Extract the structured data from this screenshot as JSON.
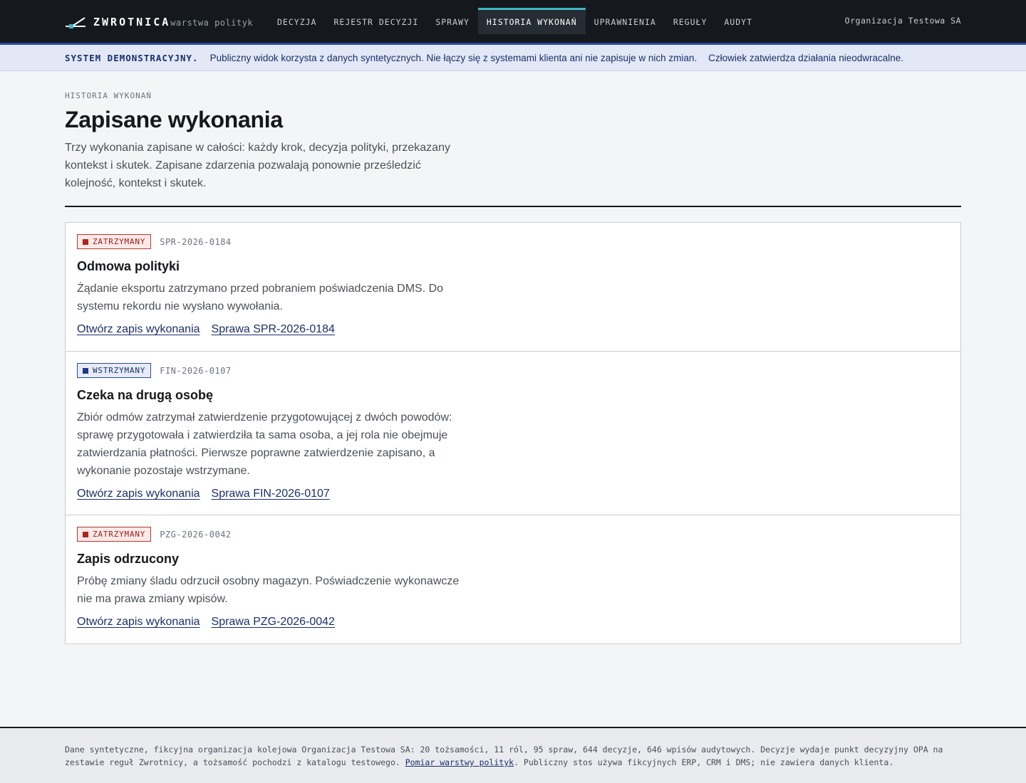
{
  "brand": {
    "name": "ZWROTNICA",
    "subtitle": "warstwa polityk",
    "logo_icon": "track-switch-icon"
  },
  "nav": {
    "items": [
      {
        "label": "DECYZJA",
        "active": false
      },
      {
        "label": "REJESTR DECYZJI",
        "active": false
      },
      {
        "label": "SPRAWY",
        "active": false
      },
      {
        "label": "HISTORIA WYKONAŃ",
        "active": true
      },
      {
        "label": "UPRAWNIENIA",
        "active": false
      },
      {
        "label": "REGUŁY",
        "active": false
      },
      {
        "label": "AUDYT",
        "active": false
      }
    ],
    "org": "Organizacja Testowa SA"
  },
  "banner": {
    "strong": "SYSTEM DEMONSTRACYJNY.",
    "text1": "Publiczny widok korzysta z danych syntetycznych. Nie łączy się z systemami klienta ani nie zapisuje w nich zmian.",
    "text2": "Człowiek zatwierdza działania nieodwracalne."
  },
  "header": {
    "eyebrow": "HISTORIA WYKONAŃ",
    "title": "Zapisane wykonania",
    "lead": "Trzy wykonania zapisane w całości: każdy krok, decyzja polityki, przekazany kontekst i skutek. Zapisane zdarzenia pozwalają ponownie prześledzić kolejność, kontekst i skutek."
  },
  "runs": [
    {
      "status": "ZATRZYMANY",
      "case_id": "SPR-2026-0184",
      "title": "Odmowa polityki",
      "description": "Żądanie eksportu zatrzymano przed pobraniem poświadczenia DMS. Do systemu rekordu nie wysłano wywołania.",
      "link_record": "Otwórz zapis wykonania",
      "link_case": "Sprawa SPR-2026-0184"
    },
    {
      "status": "WSTRZYMANY",
      "case_id": "FIN-2026-0107",
      "title": "Czeka na drugą osobę",
      "description": "Zbiór odmów zatrzymał zatwierdzenie przygotowującej z dwóch powodów: sprawę przygotowała i zatwierdziła ta sama osoba, a jej rola nie obejmuje zatwierdzania płatności. Pierwsze poprawne zatwierdzenie zapisano, a wykonanie pozostaje wstrzymane.",
      "link_record": "Otwórz zapis wykonania",
      "link_case": "Sprawa FIN-2026-0107"
    },
    {
      "status": "ZATRZYMANY",
      "case_id": "PZG-2026-0042",
      "title": "Zapis odrzucony",
      "description": "Próbę zmiany śladu odrzucił osobny magazyn. Poświadczenie wykonawcze nie ma prawa zmiany wpisów.",
      "link_record": "Otwórz zapis wykonania",
      "link_case": "Sprawa PZG-2026-0042"
    }
  ],
  "footer": {
    "text_before": "Dane syntetyczne, fikcyjna organizacja kolejowa Organizacja Testowa SA: 20 tożsamości, 11 ról, 95 spraw, 644 decyzje, 646 wpisów audytowych. Decyzje wydaje punkt decyzyjny OPA na zestawie reguł Zwrotnicy, a tożsamość pochodzi z katalogu testowego. ",
    "link": "Pomiar warstwy polityk",
    "text_after": ". Publiczny stos używa fikcyjnych ERP, CRM i DMS; nie zawiera danych klienta."
  },
  "colors": {
    "accent": "#3fb6c6",
    "stopped": "#a9271f",
    "held": "#1f3a85",
    "link": "#1b2f6b"
  }
}
